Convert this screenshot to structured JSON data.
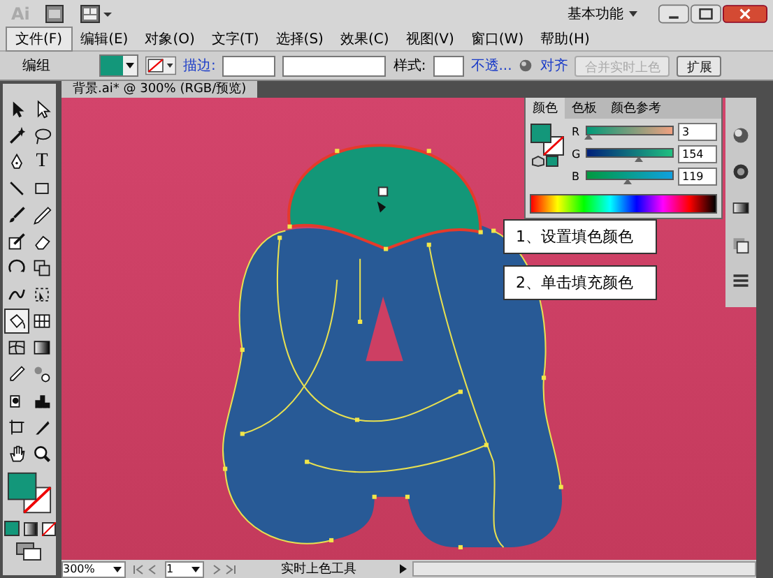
{
  "title_bar": {
    "app_logo": "Ai",
    "workspace": "基本功能"
  },
  "menu": [
    {
      "label": "文件(F)",
      "selected": true
    },
    {
      "label": "编辑(E)",
      "selected": false
    },
    {
      "label": "对象(O)",
      "selected": false
    },
    {
      "label": "文字(T)",
      "selected": false
    },
    {
      "label": "选择(S)",
      "selected": false
    },
    {
      "label": "效果(C)",
      "selected": false
    },
    {
      "label": "视图(V)",
      "selected": false
    },
    {
      "label": "窗口(W)",
      "selected": false
    },
    {
      "label": "帮助(H)",
      "selected": false
    }
  ],
  "control_bar": {
    "selection": "编组",
    "fill_swatch": {
      "color": "#13977a"
    },
    "stroke_link": "描边:",
    "style_label": "样式:",
    "opacity_link": "不透...",
    "align_link": "对齐",
    "buttons": [
      {
        "label": "合并实时上色",
        "disabled": true
      },
      {
        "label": "扩展",
        "disabled": false
      }
    ]
  },
  "document_tab": "背景.ai* @ 300% (RGB/预览)",
  "tools": [
    {
      "kind": "arrow",
      "selected": false
    },
    {
      "kind": "direct",
      "selected": false
    },
    {
      "kind": "wand",
      "selected": false
    },
    {
      "kind": "lasso",
      "selected": false
    },
    {
      "kind": "pen",
      "selected": false
    },
    {
      "kind": "type",
      "glyph": "T",
      "selected": false
    },
    {
      "kind": "line",
      "selected": false
    },
    {
      "kind": "rect",
      "selected": false
    },
    {
      "kind": "brush",
      "selected": false
    },
    {
      "kind": "pencil",
      "selected": false
    },
    {
      "kind": "blob",
      "selected": false
    },
    {
      "kind": "eraser",
      "selected": false
    },
    {
      "kind": "rotate",
      "selected": false
    },
    {
      "kind": "scale",
      "selected": false
    },
    {
      "kind": "warp",
      "selected": false
    },
    {
      "kind": "transform",
      "selected": false
    },
    {
      "kind": "bucket",
      "selected": true
    },
    {
      "kind": "graph",
      "selected": false
    },
    {
      "kind": "mesh",
      "selected": false
    },
    {
      "kind": "gradient",
      "selected": false
    },
    {
      "kind": "eyedropper",
      "selected": false
    },
    {
      "kind": "blend",
      "selected": false
    },
    {
      "kind": "symbol",
      "selected": false
    },
    {
      "kind": "columns",
      "selected": false
    },
    {
      "kind": "artboard",
      "selected": false
    },
    {
      "kind": "knife",
      "selected": false
    },
    {
      "kind": "hand",
      "selected": false
    },
    {
      "kind": "zoom",
      "selected": false
    }
  ],
  "color_panel": {
    "tabs": [
      {
        "label": "颜色",
        "selected": true
      },
      {
        "label": "色板",
        "selected": false
      },
      {
        "label": "颜色参考",
        "selected": false
      }
    ],
    "channels": [
      {
        "name": "R",
        "value": "3",
        "level": 0.01
      },
      {
        "name": "G",
        "value": "154",
        "level": 0.6
      },
      {
        "name": "B",
        "value": "119",
        "level": 0.47
      }
    ]
  },
  "callouts": [
    "1、设置填色颜色",
    "2、单击填充颜色"
  ],
  "status_bar": {
    "zoom": "300%",
    "artboard": "1",
    "tool": "实时上色工具"
  }
}
